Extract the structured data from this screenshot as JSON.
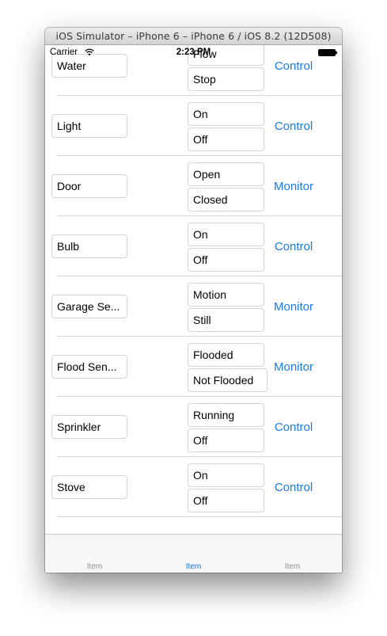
{
  "window": {
    "title": "iOS Simulator – iPhone 6 – iPhone 6 / iOS 8.2 (12D508)"
  },
  "status_bar": {
    "carrier": "Carrier",
    "time": "2:23 PM",
    "wifi_icon": "wifi-icon",
    "battery_icon": "battery-icon"
  },
  "rows": [
    {
      "name": "Water",
      "state_on": "Flow",
      "state_off": "Stop",
      "action": "Control"
    },
    {
      "name": "Light",
      "state_on": "On",
      "state_off": "Off",
      "action": "Control"
    },
    {
      "name": "Door",
      "state_on": "Open",
      "state_off": "Closed",
      "action": "Monitor"
    },
    {
      "name": "Bulb",
      "state_on": "On",
      "state_off": "Off",
      "action": "Control"
    },
    {
      "name": "Garage Se...",
      "state_on": "Motion",
      "state_off": "Still",
      "action": "Monitor"
    },
    {
      "name": "Flood Sen...",
      "state_on": "Flooded",
      "state_off": "Not Flooded",
      "action": "Monitor"
    },
    {
      "name": "Sprinkler",
      "state_on": "Running",
      "state_off": "Off",
      "action": "Control"
    },
    {
      "name": "Stove",
      "state_on": "On",
      "state_off": "Off",
      "action": "Control"
    }
  ],
  "tab_bar": {
    "selected_index": 1,
    "tabs": [
      {
        "label": "Item"
      },
      {
        "label": "Item"
      },
      {
        "label": "Item"
      }
    ]
  },
  "colors": {
    "accent": "#1a7ae6",
    "tab_inactive": "#929292"
  }
}
